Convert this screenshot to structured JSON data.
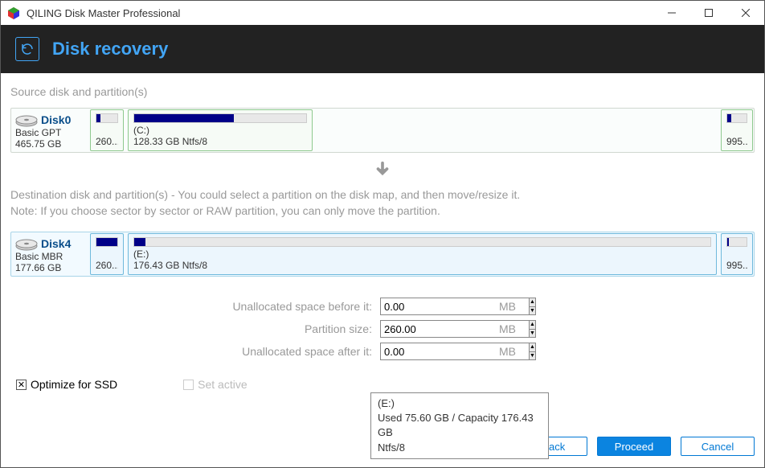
{
  "window": {
    "title": "QILING Disk Master Professional"
  },
  "page": {
    "title": "Disk recovery"
  },
  "source": {
    "section_title": "Source disk and partition(s)",
    "disk": {
      "name": "Disk0",
      "type": "Basic GPT",
      "size": "465.75 GB"
    },
    "parts": [
      {
        "drive": "",
        "label": "260...",
        "fill_pct": 18
      },
      {
        "drive": "(C:)",
        "label": "128.33 GB Ntfs/8",
        "fill_pct": 58
      },
      {
        "drive": "",
        "label": "995...",
        "fill_pct": 22
      }
    ]
  },
  "dest": {
    "note1": "Destination disk and partition(s) - You could select a partition on the disk map, and then move/resize it.",
    "note2": "Note: If you choose sector by sector or RAW partition, you can only move the partition.",
    "disk": {
      "name": "Disk4",
      "type": "Basic MBR",
      "size": "177.66 GB"
    },
    "parts": [
      {
        "drive": "",
        "label": "260...",
        "fill_pct": 100
      },
      {
        "drive": "(E:)",
        "label": "176.43 GB Ntfs/8",
        "fill_pct": 2
      },
      {
        "drive": "",
        "label": "995...",
        "fill_pct": 8
      }
    ]
  },
  "fields": {
    "unalloc_before_label": "Unallocated space before it:",
    "unalloc_before_value": "0.00",
    "psize_label": "Partition size:",
    "psize_value": "260.00",
    "unalloc_after_label": "Unallocated space after it:",
    "unalloc_after_value": "0.00",
    "unit": "MB"
  },
  "tooltip": {
    "line1": "(E:)",
    "line2": "Used 75.60 GB / Capacity 176.43 GB",
    "line3": "Ntfs/8"
  },
  "checks": {
    "ssd": "Optimize for SSD",
    "active": "Set active"
  },
  "buttons": {
    "back": "<Back",
    "proceed": "Proceed",
    "cancel": "Cancel"
  }
}
